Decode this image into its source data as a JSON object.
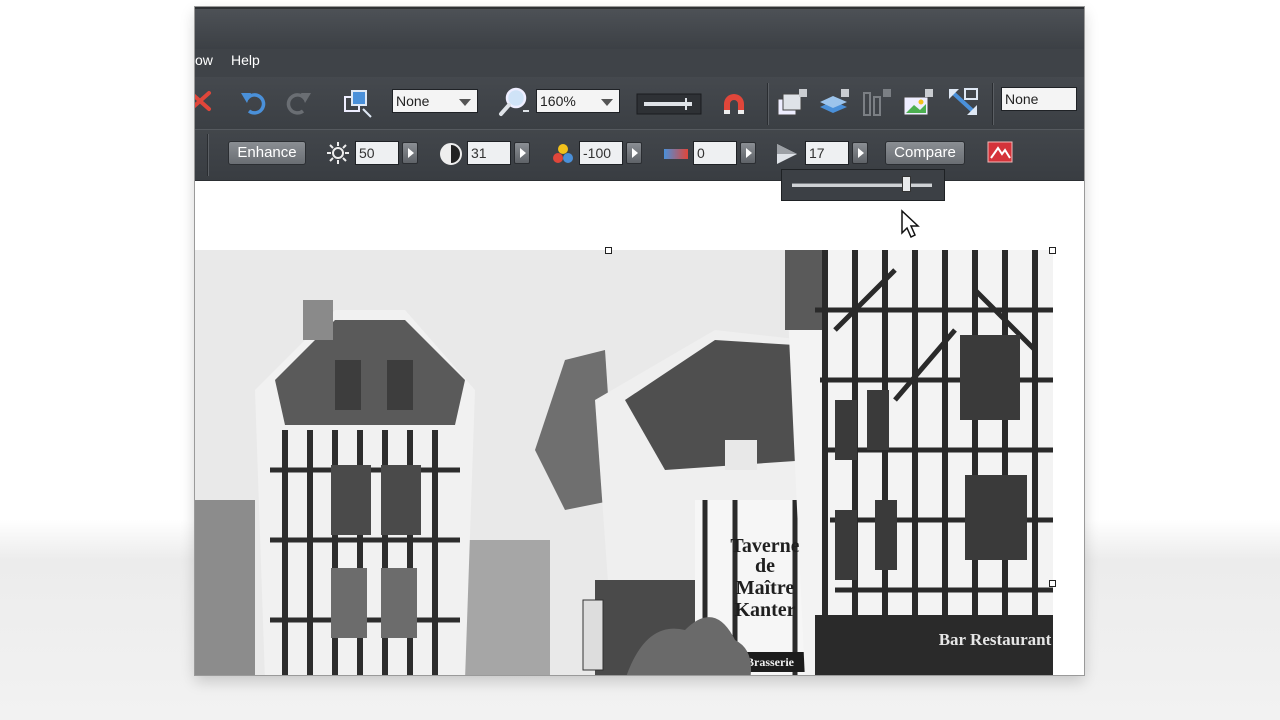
{
  "menu": {
    "partial_label": "ow",
    "help_label": "Help"
  },
  "toolbar1": {
    "fill_combo": {
      "value": "None"
    },
    "zoom_combo": {
      "value": "160%"
    },
    "right_combo": {
      "value": "None"
    }
  },
  "toolbar2": {
    "enhance_label": "Enhance",
    "brightness": "50",
    "contrast": "31",
    "saturation": "-100",
    "temperature": "0",
    "sharpness": "17",
    "compare_label": "Compare"
  },
  "sharpness_slider": {
    "value": 17
  },
  "photo_signs": {
    "tavern_line1": "Taverne",
    "tavern_line2": "de",
    "tavern_line3": "Maître",
    "tavern_line4": "Kanter",
    "brasserie": "Brasserie",
    "bar_restaurant": "Bar Restaurant"
  },
  "colors": {
    "chrome_dark": "#3c4045",
    "undo_blue": "#4a90d9",
    "magnet_red": "#e0463a"
  }
}
